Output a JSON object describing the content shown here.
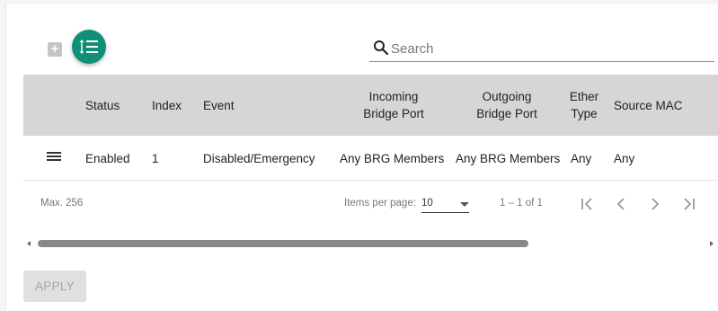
{
  "toolbar": {
    "add_label": "+",
    "search_placeholder": "Search",
    "accent_color": "#0f8e78"
  },
  "table": {
    "headers": {
      "status": "Status",
      "index": "Index",
      "event": "Event",
      "incoming_line1": "Incoming",
      "incoming_line2": "Bridge Port",
      "outgoing_line1": "Outgoing",
      "outgoing_line2": "Bridge Port",
      "ether_line1": "Ether",
      "ether_line2": "Type",
      "source_mac": "Source MAC"
    },
    "rows": [
      {
        "status": "Enabled",
        "index": "1",
        "event": "Disabled/Emergency",
        "incoming": "Any BRG Members",
        "outgoing": "Any BRG Members",
        "ether_type": "Any",
        "source_mac": "Any"
      }
    ]
  },
  "paginator": {
    "max": "Max. 256",
    "items_per_page_label": "Items per page:",
    "items_per_page_value": "10",
    "range": "1 – 1 of 1"
  },
  "scrollbar": {
    "thumb_fraction": 0.73
  },
  "footer": {
    "apply_label": "APPLY"
  }
}
